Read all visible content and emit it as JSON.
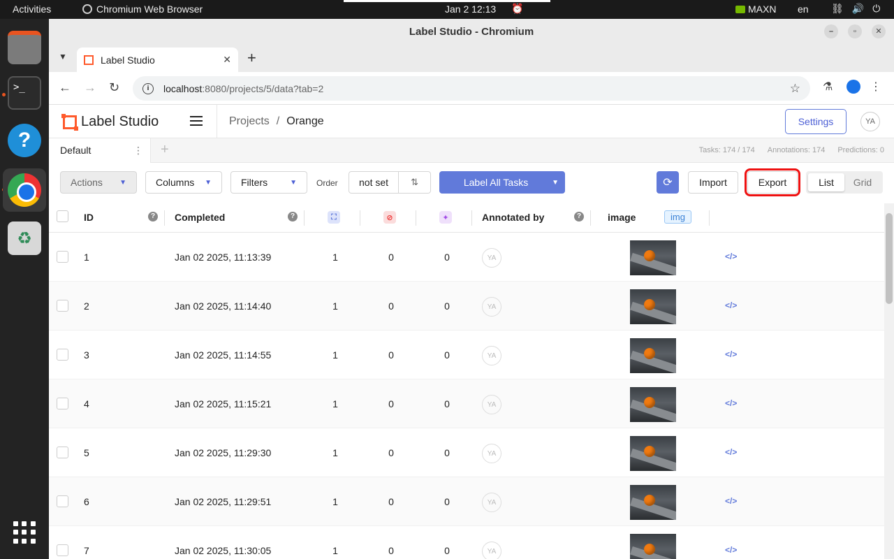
{
  "system": {
    "activities": "Activities",
    "app_name": "Chromium Web Browser",
    "clock": "Jan 2  12:13",
    "gpu_mode": "MAXN",
    "language": "en"
  },
  "browser": {
    "window_title": "Label Studio - Chromium",
    "tab_title": "Label Studio",
    "url_host": "localhost",
    "url_rest": ":8080/projects/5/data?tab=2"
  },
  "app": {
    "logo_text": "Label Studio",
    "breadcrumb": {
      "root": "Projects",
      "separator": "/",
      "current": "Orange"
    },
    "settings_label": "Settings",
    "user_initials": "YA"
  },
  "views": {
    "tab_label": "Default",
    "stats": {
      "tasks": "Tasks: 174 / 174",
      "annotations": "Annotations: 174",
      "predictions": "Predictions: 0"
    }
  },
  "actionbar": {
    "actions": "Actions",
    "columns": "Columns",
    "filters": "Filters",
    "order_label": "Order",
    "order_value": "not set",
    "label_all": "Label All Tasks",
    "import": "Import",
    "export": "Export",
    "view_list": "List",
    "view_grid": "Grid"
  },
  "table": {
    "headers": {
      "id": "ID",
      "completed": "Completed",
      "annotated_by": "Annotated by",
      "image": "image",
      "image_type": "img"
    },
    "rows": [
      {
        "id": "1",
        "completed": "Jan 02 2025, 11:13:39",
        "annotations": "1",
        "cancelled": "0",
        "predictions": "0",
        "annotator": "YA"
      },
      {
        "id": "2",
        "completed": "Jan 02 2025, 11:14:40",
        "annotations": "1",
        "cancelled": "0",
        "predictions": "0",
        "annotator": "YA"
      },
      {
        "id": "3",
        "completed": "Jan 02 2025, 11:14:55",
        "annotations": "1",
        "cancelled": "0",
        "predictions": "0",
        "annotator": "YA"
      },
      {
        "id": "4",
        "completed": "Jan 02 2025, 11:15:21",
        "annotations": "1",
        "cancelled": "0",
        "predictions": "0",
        "annotator": "YA"
      },
      {
        "id": "5",
        "completed": "Jan 02 2025, 11:29:30",
        "annotations": "1",
        "cancelled": "0",
        "predictions": "0",
        "annotator": "YA"
      },
      {
        "id": "6",
        "completed": "Jan 02 2025, 11:29:51",
        "annotations": "1",
        "cancelled": "0",
        "predictions": "0",
        "annotator": "YA"
      },
      {
        "id": "7",
        "completed": "Jan 02 2025, 11:30:05",
        "annotations": "1",
        "cancelled": "0",
        "predictions": "0",
        "annotator": "YA"
      }
    ]
  }
}
